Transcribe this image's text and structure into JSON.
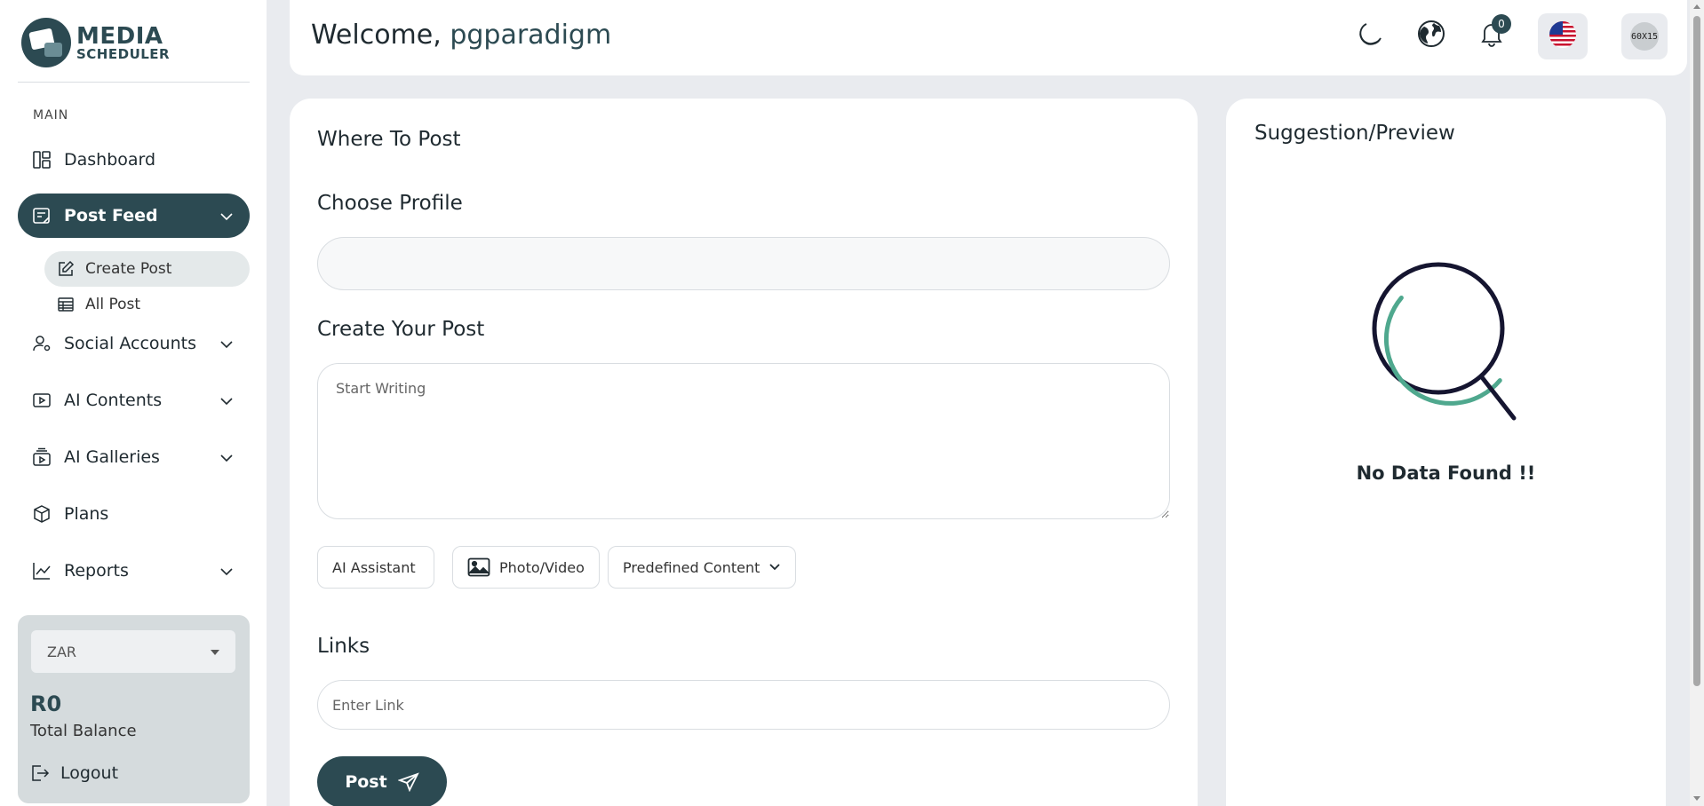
{
  "brand": {
    "line1": "MEDIA",
    "line2": "SCHEDULER"
  },
  "sidebar": {
    "section_label": "MAIN",
    "items": [
      {
        "label": "Dashboard",
        "icon": "dashboard-icon"
      },
      {
        "label": "Post Feed",
        "icon": "post-feed-icon",
        "active": true
      },
      {
        "label": "Social Accounts",
        "icon": "user-settings-icon"
      },
      {
        "label": "AI Contents",
        "icon": "play-icon"
      },
      {
        "label": "AI Galleries",
        "icon": "gallery-icon"
      },
      {
        "label": "Plans",
        "icon": "box-icon"
      },
      {
        "label": "Reports",
        "icon": "chart-line-icon"
      }
    ],
    "sub_items": [
      {
        "label": "Create Post",
        "icon": "edit-icon",
        "active": true
      },
      {
        "label": "All Post",
        "icon": "table-icon"
      }
    ],
    "balance": {
      "currency": "ZAR",
      "amount": "R0",
      "label": "Total Balance",
      "logout_label": "Logout"
    }
  },
  "header": {
    "welcome_prefix": "Welcome,",
    "username": "pgparadigm",
    "notification_count": "0",
    "avatar_text": "60X15"
  },
  "main": {
    "where_to_post": "Where To Post",
    "choose_profile": "Choose Profile",
    "create_post": "Create Your Post",
    "post_placeholder": "Start Writing",
    "ai_assistant": "AI Assistant",
    "photo_video": "Photo/Video",
    "predefined": "Predefined Content",
    "links_title": "Links",
    "link_placeholder": "Enter Link",
    "post_button": "Post"
  },
  "preview": {
    "title": "Suggestion/Preview",
    "empty": "No Data Found !!"
  },
  "colors": {
    "accent": "#2c4a52",
    "background": "#e9ebef",
    "magnifier_arc": "#4fa88e",
    "magnifier_ring": "#151530"
  }
}
